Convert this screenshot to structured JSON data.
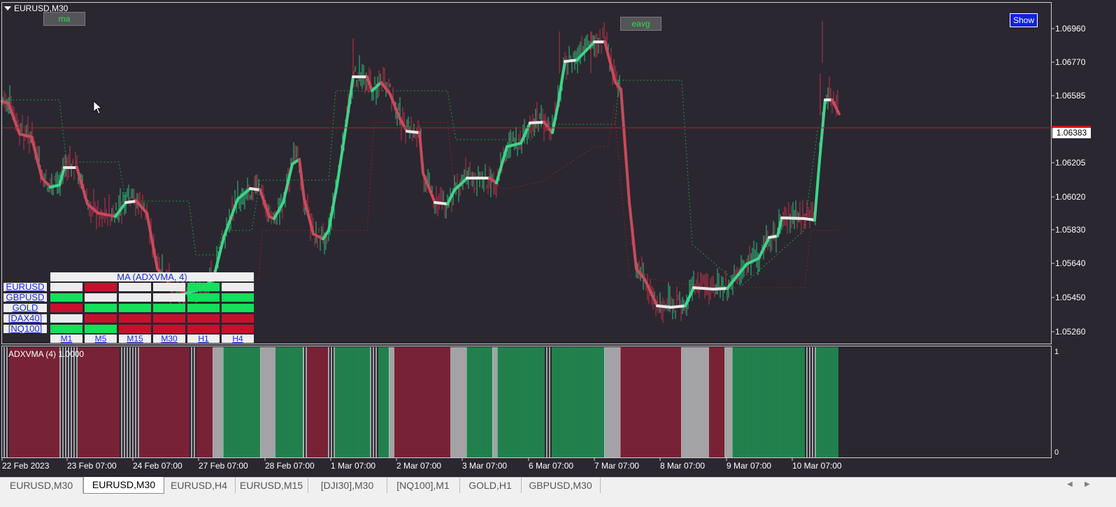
{
  "window": {
    "title": "EURUSD,M30"
  },
  "buttons": {
    "ma": "ma",
    "eavg": "eavg",
    "show": "Show"
  },
  "price_axis": [
    "1.06960",
    "1.06770",
    "1.06585",
    "1.06205",
    "1.06020",
    "1.05830",
    "1.05640",
    "1.05450",
    "1.05260"
  ],
  "current_price": "1.06383",
  "time_axis": [
    "22 Feb 2023",
    "23 Feb 07:00",
    "24 Feb 07:00",
    "27 Feb 07:00",
    "28 Feb 07:00",
    "1 Mar 07:00",
    "2 Mar 07:00",
    "3 Mar 07:00",
    "6 Mar 07:00",
    "7 Mar 07:00",
    "8 Mar 07:00",
    "9 Mar 07:00",
    "10 Mar 07:00"
  ],
  "indicator": {
    "label": "ADXVMA (4) 1.0000",
    "axis_top": "1",
    "axis_bottom": "0"
  },
  "dashboard": {
    "title": "MA (ADXVMA, 4)",
    "symbols": [
      "EURUSD",
      "GBPUSD",
      "GOLD",
      "[DAX40]",
      "[NQ100]"
    ],
    "timeframes": [
      "M1",
      "M5",
      "M15",
      "M30",
      "H1",
      "H4"
    ],
    "states": [
      [
        "neutral",
        "down",
        "neutral",
        "neutral",
        "up",
        "neutral"
      ],
      [
        "up",
        "neutral",
        "neutral",
        "neutral",
        "up",
        "up"
      ],
      [
        "down",
        "up",
        "up",
        "up",
        "up",
        "up"
      ],
      [
        "neutral",
        "down",
        "down",
        "down",
        "down",
        "down"
      ],
      [
        "up",
        "up",
        "down",
        "down",
        "down",
        "down"
      ]
    ],
    "colors": {
      "up": "#14e05a",
      "down": "#c8102e",
      "neutral": "#ececec"
    }
  },
  "tabs": [
    "EURUSD,M30",
    "EURUSD,M30",
    "EURUSD,H4",
    "EURUSD,M15",
    "[DJI30],M30",
    "[NQ100],M1",
    "GOLD,H1",
    "GBPUSD,M30"
  ],
  "active_tab": 1,
  "colors": {
    "bg": "#2a2730",
    "bull": "#2ec27e",
    "bear": "#c0304a",
    "ma_up": "#3fd48a",
    "ma_down": "#c84a5c",
    "ma_flat": "#e8e8e8"
  }
}
